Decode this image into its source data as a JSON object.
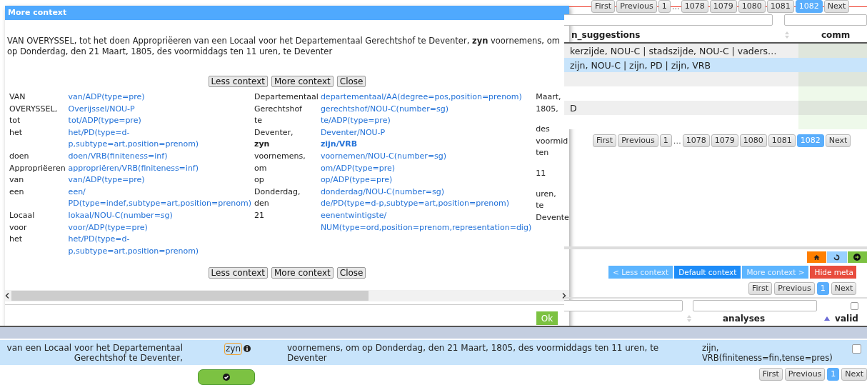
{
  "dialog": {
    "title": "More context",
    "sentence": "VAN OVERYSSEL, tot het doen Appropriëeren van een Locaal voor het Departementaal Gerechtshof te Deventer, **zyn** voornemens, om op Donderdag, den 21 Maart, 1805, des voormiddags ten 11 uren, te Deventer",
    "top_buttons": [
      "Less context",
      "More context",
      "Close"
    ],
    "groups": [
      {
        "rows": [
          {
            "word": "VAN",
            "analysis": [
              "van/ADP(type=pre)"
            ],
            "highlight": false
          },
          {
            "word": "OVERYSSEL,",
            "analysis": [
              "Overijssel/NOU-P"
            ],
            "highlight": false
          },
          {
            "word": "tot",
            "analysis": [
              "tot/ADP(type=pre)"
            ],
            "highlight": false
          },
          {
            "word": "het",
            "analysis": [
              "het/PD(type=d-",
              "p,subtype=art,position=prenom)"
            ],
            "highlight": false
          },
          {
            "word": "doen",
            "analysis": [
              "doen/VRB(finiteness=inf)"
            ],
            "highlight": false
          },
          {
            "word": "Appropriëeren",
            "analysis": [
              "appropriëren/VRB(finiteness=inf)"
            ],
            "highlight": false
          },
          {
            "word": "van",
            "analysis": [
              "van/ADP(type=pre)"
            ],
            "highlight": false
          },
          {
            "word": "een",
            "analysis": [
              "een/",
              "PD(type=indef,subtype=art,position=prenom)"
            ],
            "highlight": false
          },
          {
            "word": "Locaal",
            "analysis": [
              "lokaal/NOU-C(number=sg)"
            ],
            "highlight": false
          },
          {
            "word": "voor",
            "analysis": [
              "voor/ADP(type=pre)"
            ],
            "highlight": false
          },
          {
            "word": "het",
            "analysis": [
              "het/PD(type=d-",
              "p,subtype=art,position=prenom)"
            ],
            "highlight": false
          }
        ]
      },
      {
        "rows": [
          {
            "word": "Departementaal",
            "analysis": [
              "departementaal/AA(degree=pos,position=prenom)"
            ],
            "highlight": false
          },
          {
            "word": "Gerechtshof",
            "analysis": [
              "gerechtshof/NOU-C(number=sg)"
            ],
            "highlight": false
          },
          {
            "word": "te",
            "analysis": [
              "te/ADP(type=pre)"
            ],
            "highlight": false
          },
          {
            "word": "Deventer,",
            "analysis": [
              "Deventer/NOU-P"
            ],
            "highlight": false
          },
          {
            "word": "zyn",
            "analysis": [
              "zijn/VRB"
            ],
            "highlight": true
          },
          {
            "word": "voornemens,",
            "analysis": [
              "voornemen/NOU-C(number=sg)"
            ],
            "highlight": false
          },
          {
            "word": "om",
            "analysis": [
              "om/ADP(type=pre)"
            ],
            "highlight": false
          },
          {
            "word": "op",
            "analysis": [
              "op/ADP(type=pre)"
            ],
            "highlight": false
          },
          {
            "word": "Donderdag,",
            "analysis": [
              "donderdag/NOU-C(number=sg)"
            ],
            "highlight": false
          },
          {
            "word": "den",
            "analysis": [
              "de/PD(type=d-p,subtype=art,position=prenom)"
            ],
            "highlight": false
          },
          {
            "word": "21",
            "analysis": [
              "eenentwintigste/",
              "NUM(type=ord,position=prenom,representation=dig)"
            ],
            "highlight": false
          }
        ]
      }
    ],
    "trailing_column": [
      {
        "lines": [
          "Maart,",
          "1805,"
        ]
      },
      {
        "lines": [
          "des",
          "voormid",
          "ten"
        ]
      },
      {
        "lines": [
          "11"
        ]
      },
      {
        "lines": [
          "uren,",
          "te",
          "Devente"
        ]
      }
    ],
    "bottom_buttons": [
      "Less context",
      "More context",
      "Close"
    ],
    "ok_button": "Ok"
  },
  "suggestions_table": {
    "top_pager": [
      {
        "label": "First",
        "kind": "button",
        "selected": false
      },
      {
        "label": "Previous",
        "kind": "button",
        "selected": false
      },
      {
        "label": "1",
        "kind": "button",
        "selected": false
      },
      {
        "label": "…",
        "kind": "gap"
      },
      {
        "label": "1078",
        "kind": "button",
        "selected": false
      },
      {
        "label": "1079",
        "kind": "button",
        "selected": false
      },
      {
        "label": "1080",
        "kind": "button",
        "selected": false
      },
      {
        "label": "1081",
        "kind": "button",
        "selected": false
      },
      {
        "label": "1082",
        "kind": "button",
        "selected": true
      },
      {
        "label": "Next",
        "kind": "button",
        "selected": false
      }
    ],
    "columns": [
      "n_suggestions",
      "comm"
    ],
    "rows": [
      {
        "text": "kerzijde, NOU-C | stadszijde, NOU-C | vaders…",
        "selected": false
      },
      {
        "text": "zijn, NOU-C | zijn, PD | zijn, VRB",
        "selected": true
      },
      {
        "selected": false
      },
      {
        "selected": false
      },
      {
        "text": "D",
        "selected": false
      },
      {
        "selected": false
      }
    ],
    "pager": [
      {
        "label": "First",
        "kind": "button",
        "selected": false
      },
      {
        "label": "Previous",
        "kind": "button",
        "selected": false
      },
      {
        "label": "1",
        "kind": "button",
        "selected": false
      },
      {
        "label": "…",
        "kind": "gap"
      },
      {
        "label": "1078",
        "kind": "button",
        "selected": false
      },
      {
        "label": "1079",
        "kind": "button",
        "selected": false
      },
      {
        "label": "1080",
        "kind": "button",
        "selected": false
      },
      {
        "label": "1081",
        "kind": "button",
        "selected": false
      },
      {
        "label": "1082",
        "kind": "button",
        "selected": true
      },
      {
        "label": "Next",
        "kind": "button",
        "selected": false
      }
    ]
  },
  "analysis_panel": {
    "context_buttons": [
      {
        "label": "< Less context",
        "selected": false
      },
      {
        "label": "Default context",
        "selected": true
      },
      {
        "label": "More context >",
        "selected": false
      }
    ],
    "hide_button": "Hide meta",
    "pager": [
      {
        "label": "First",
        "kind": "button",
        "selected": false
      },
      {
        "label": "Previous",
        "kind": "button",
        "selected": false
      },
      {
        "label": "1",
        "kind": "button",
        "selected": true
      },
      {
        "label": "Next",
        "kind": "button",
        "selected": false
      }
    ],
    "select_all_checked": false,
    "columns": [
      "analyses",
      "valid"
    ],
    "row": {
      "left_context": [
        "van een Locaal voor het Departementaal",
        "Gerechtshof te Deventer,"
      ],
      "keyword": "zyn",
      "right_context": "voornemens, om op Donderdag, den 21 Maart, 1805, des voormiddags ten 11 uren, te Deventer",
      "analysis": [
        "zijn,",
        "VRB(finiteness=fin,tense=pres)"
      ],
      "valid": false
    },
    "bottom_pager": [
      {
        "label": "First",
        "kind": "button",
        "selected": false
      },
      {
        "label": "Previous",
        "kind": "button",
        "selected": false
      },
      {
        "label": "1",
        "kind": "button",
        "selected": true
      },
      {
        "label": "Next",
        "kind": "button",
        "selected": false
      }
    ]
  }
}
